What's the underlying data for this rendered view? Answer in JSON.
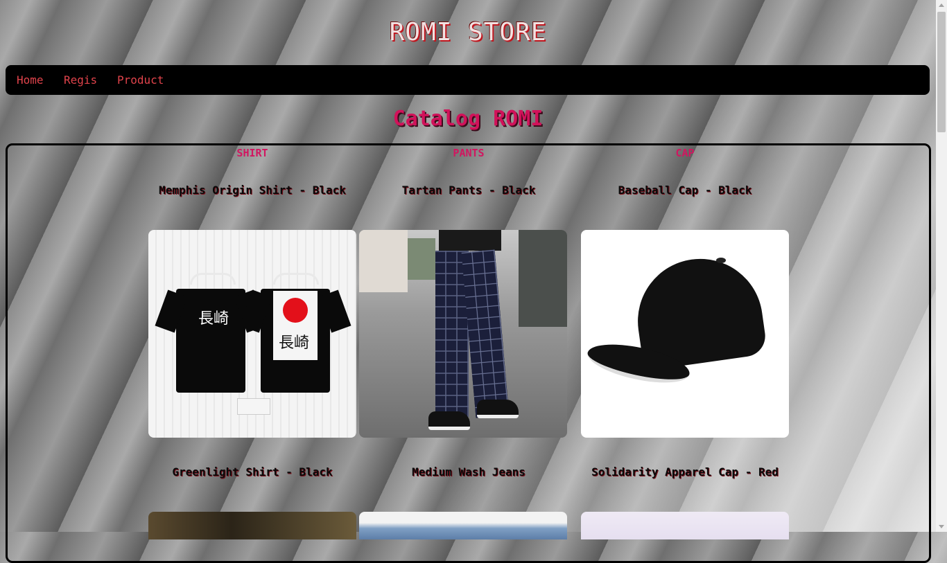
{
  "header": {
    "title": "ROMI STORE"
  },
  "nav": {
    "items": [
      "Home",
      "Regis",
      "Product"
    ]
  },
  "catalog": {
    "title": "Catalog ROMI",
    "categories": [
      "SHIRT",
      "PANTS",
      "CAP"
    ],
    "rows": [
      [
        "Memphis Origin Shirt - Black",
        "Tartan Pants - Black",
        "Baseball Cap - Black"
      ],
      [
        "Greenlight Shirt - Black",
        "Medium Wash Jeans",
        "Solidarity Apparel Cap - Red"
      ]
    ],
    "image_icons": [
      "shirt-photo",
      "pants-photo",
      "cap-photo"
    ]
  },
  "colors": {
    "accent_red": "#e0434b",
    "title_pink": "#d1125a",
    "nav_bg": "#000000"
  }
}
